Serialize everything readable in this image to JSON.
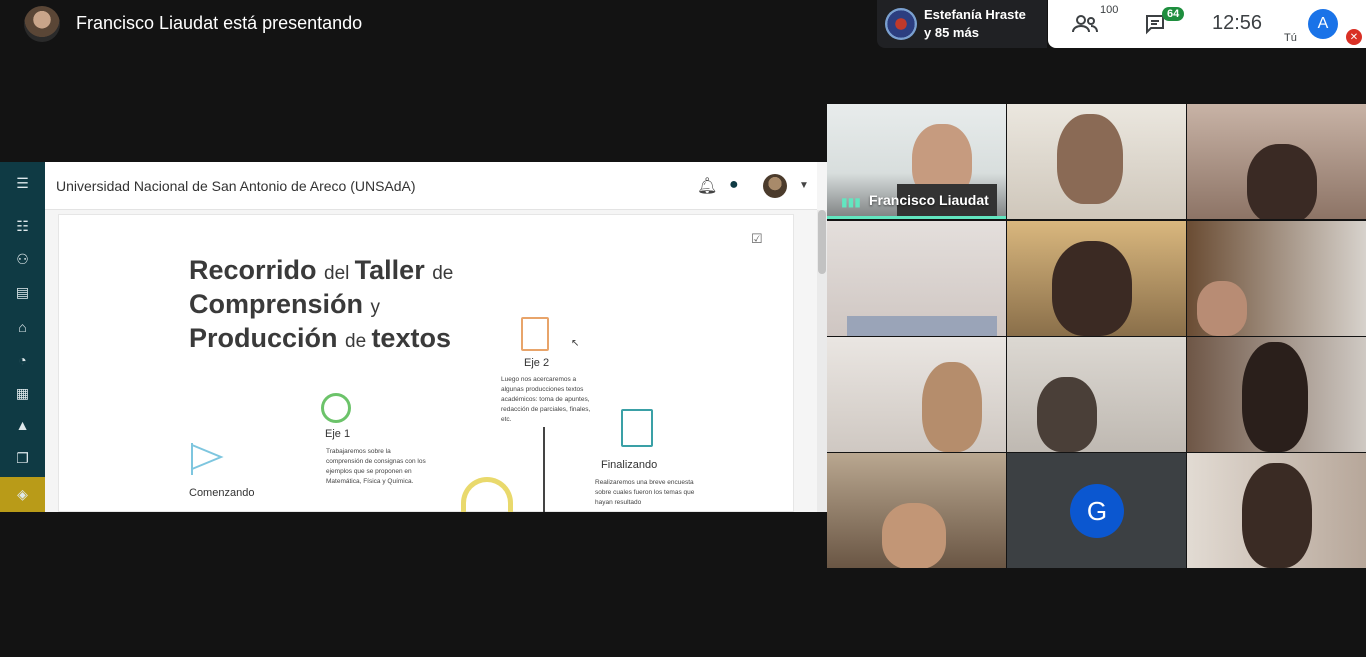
{
  "meeting": {
    "presenting_title": "Francisco Liaudat está presentando",
    "participant_chip": {
      "line1": "Estefanía Hraste",
      "line2": "y 85 más"
    },
    "participants_count": "100",
    "chat_unread": "64",
    "clock": "12:56",
    "self_initial": "A",
    "self_label": "Tú"
  },
  "shared_screen": {
    "site_title": "Universidad Nacional de San Antonio de Areco (UNSAdA)",
    "poster": {
      "title_line1_a": "Recorrido ",
      "title_line1_b": "del ",
      "title_line1_c": "Taller ",
      "title_line1_d": "de",
      "title_line2_a": "Comprensión ",
      "title_line2_b": "y",
      "title_line3_a": "Producción ",
      "title_line3_b": "de ",
      "title_line3_c": "textos",
      "eje2_label": "Eje 2",
      "eje2_desc": "Luego nos acercaremos a algunas producciones textos académicos: toma de apuntes, redacción de parciales, finales, etc.",
      "eje1_label": "Eje 1",
      "eje1_desc": "Trabajaremos sobre la comprensión de consignas con los ejemplos que se proponen en Matemática, Física y Química.",
      "start_label": "Comenzando",
      "end_label": "Finalizando",
      "end_desc": "Realizaremos una breve encuesta sobre cuales fueron los temas que hayan resultado"
    }
  },
  "tiles": {
    "speaker_name": "Francisco Liaudat",
    "g_initial": "G"
  },
  "colors": {
    "nav_bg": "#0f3a44",
    "nav_active": "#b99b18",
    "speaking": "#62e6c0",
    "avatar_blue": "#0b57d0"
  }
}
